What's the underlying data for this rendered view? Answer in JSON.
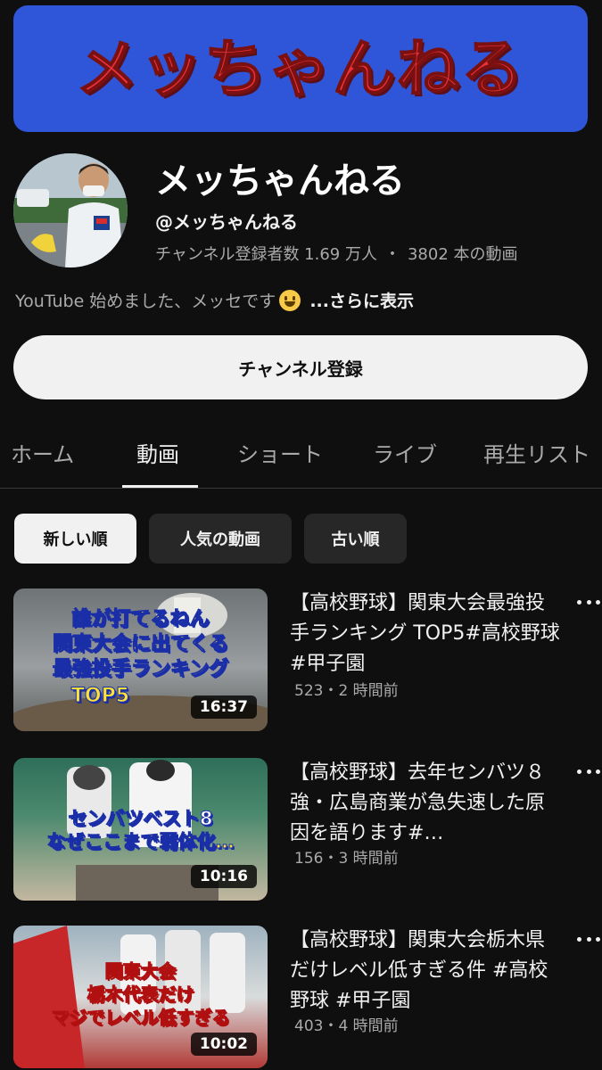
{
  "banner": {
    "text": "メッちゃんねる"
  },
  "channel": {
    "name": "メッちゃんねる",
    "handle": "@メッちゃんねる",
    "subscribers": "チャンネル登録者数 1.69 万人",
    "separator": "・",
    "video_count": "3802 本の動画",
    "description": "YouTube 始めました、メッセです",
    "description_emoji": "smile-emoji",
    "more_label": "...さらに表示"
  },
  "subscribe_label": "チャンネル登録",
  "tabs": [
    {
      "label": "ホーム"
    },
    {
      "label": "動画"
    },
    {
      "label": "ショート"
    },
    {
      "label": "ライブ"
    },
    {
      "label": "再生リスト"
    }
  ],
  "active_tab": "動画",
  "chips": [
    {
      "label": "新しい順"
    },
    {
      "label": "人気の動画"
    },
    {
      "label": "古い順"
    }
  ],
  "active_chip": "新しい順",
  "videos": [
    {
      "title": "【高校野球】関東大会最強投手ランキング TOP5#高校野球 #甲子園",
      "meta": "523・2 時間前",
      "duration": "16:37",
      "thumb_lines": [
        "誰が打てるねん",
        "関東大会に出てくる",
        "最強投手ランキング",
        "TOP5"
      ]
    },
    {
      "title": "【高校野球】去年センバツ８強・広島商業が急失速した原因を語ります#…",
      "meta": "156・3 時間前",
      "duration": "10:16",
      "thumb_lines": [
        "センバツベスト8",
        "なぜここまで弱体化…"
      ]
    },
    {
      "title": "【高校野球】関東大会栃木県だけレベル低すぎる件 #高校野球 #甲子園",
      "meta": "403・4 時間前",
      "duration": "10:02",
      "thumb_lines": [
        "関東大会",
        "栃木代表だけ",
        "マジでレベル低すぎる"
      ]
    }
  ],
  "colors": {
    "background": "#0f0f0f",
    "banner_blue": "#2f55d8",
    "banner_text_red": "#e8323b",
    "secondary_text": "#aaaaaa"
  }
}
